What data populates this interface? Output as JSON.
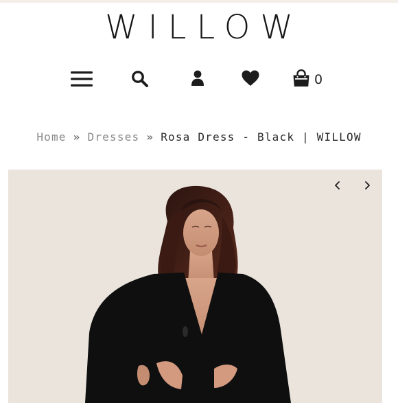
{
  "header": {
    "logo_text": "WILLOW",
    "cart_count": "0",
    "icons": [
      "menu-icon",
      "search-icon",
      "account-icon",
      "wishlist-heart-icon",
      "cart-bag-icon"
    ]
  },
  "breadcrumb": {
    "items": [
      {
        "label": "Home"
      },
      {
        "label": "Dresses"
      }
    ],
    "separator": "»",
    "current": "Rosa Dress - Black | WILLOW"
  },
  "gallery": {
    "background_color": "#ebe4dd",
    "prev_icon": "chevron-left-icon",
    "next_icon": "chevron-right-icon"
  }
}
